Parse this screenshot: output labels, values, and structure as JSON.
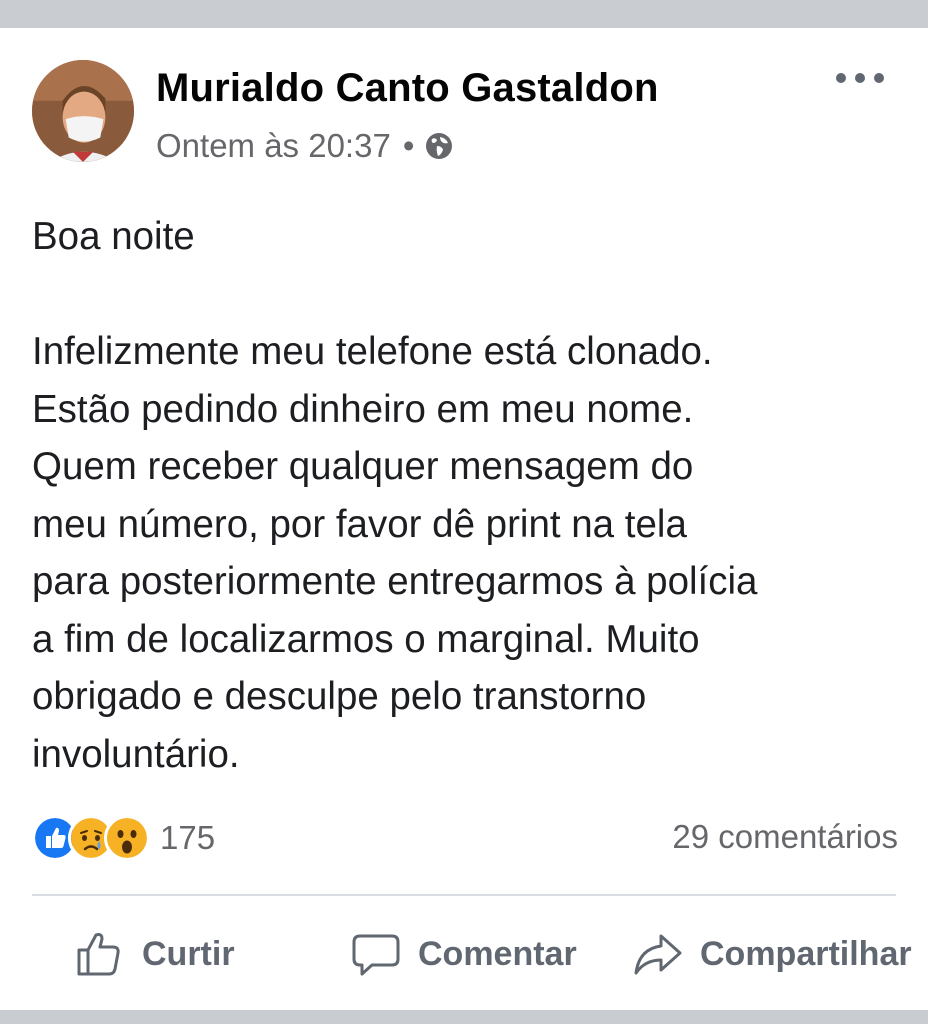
{
  "post": {
    "author": "Murialdo Canto Gastaldon",
    "timestamp": "Ontem às 20:37",
    "separator": "•",
    "privacy_icon": "globe-icon",
    "more_icon": "more-options-icon",
    "body": {
      "greeting": "Boa noite",
      "lines": [
        "Infelizmente meu telefone está clonado.",
        "Estão pedindo dinheiro em meu nome.",
        "Quem receber qualquer mensagem do",
        "meu número, por favor dê print na tela",
        "para posteriormente entregarmos à polícia",
        "a fim de localizarmos o marginal. Muito",
        "obrigado e desculpe pelo transtorno",
        "involuntário."
      ]
    }
  },
  "stats": {
    "reactions": [
      "like",
      "sad",
      "wow"
    ],
    "reaction_count": "175",
    "comments": "29 comentários"
  },
  "actions": {
    "like": "Curtir",
    "comment": "Comentar",
    "share": "Compartilhar"
  },
  "colors": {
    "background": "#c9ccd1",
    "card": "#ffffff",
    "text": "#1c1e21",
    "secondary_text": "#65676b",
    "like_blue": "#1877f2",
    "reaction_yellow": "#f7b125"
  }
}
